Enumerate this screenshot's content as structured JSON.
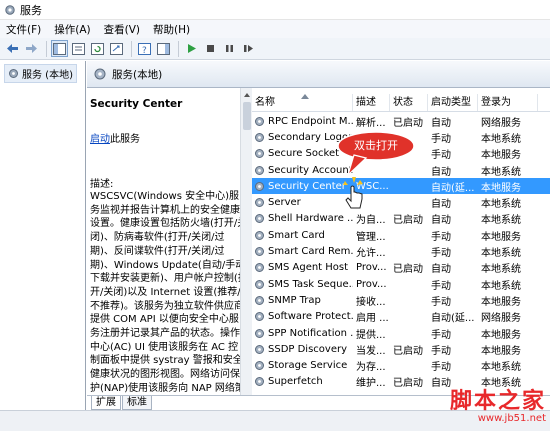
{
  "window": {
    "title": "服务"
  },
  "menu": [
    "文件(F)",
    "操作(A)",
    "查看(V)",
    "帮助(H)"
  ],
  "tree": {
    "root_label": "服务 (本地)"
  },
  "panel_header": "服务(本地)",
  "detail": {
    "service_name": "Security Center",
    "start_link": "启动",
    "start_suffix": "此服务",
    "desc_label": "描述:",
    "desc_text": "WSCSVC(Windows 安全中心)服务监视并报告计算机上的安全健康设置。健康设置包括防火墙(打开/关闭)、防病毒软件(打开/关闭/过期)、反间谍软件(打开/关闭/过期)、Windows Update(自动/手动下载并安装更新)、用户帐户控制(打开/关闭)以及 Internet 设置(推荐/不推荐)。该服务为独立软件供应商提供 COM API 以便向安全中心服务注册并记录其产品的状态。操作中心(AC) UI 使用该服务在 AC 控制面板中提供 systray 警报和安全健康状况的图形视图。网络访问保护(NAP)使用该服务向 NAP 网络策略服务报告客户端的"
  },
  "columns": [
    "名称",
    "描述",
    "状态",
    "启动类型",
    "登录为"
  ],
  "rows": [
    {
      "name": "RPC Endpoint M...",
      "desc": "解析...",
      "status": "已启动",
      "startup": "自动",
      "logon": "网络服务"
    },
    {
      "name": "Secondary Logon",
      "desc": "",
      "status": "",
      "startup": "手动",
      "logon": "本地系统"
    },
    {
      "name": "Secure Socket",
      "desc": "",
      "status": "",
      "startup": "手动",
      "logon": "本地服务"
    },
    {
      "name": "Security Account",
      "desc": "",
      "status": "",
      "startup": "自动",
      "logon": "本地系统"
    },
    {
      "name": "Security Center",
      "desc": "WSC...",
      "status": "",
      "startup": "自动(延...",
      "logon": "本地服务"
    },
    {
      "name": "Server",
      "desc": "",
      "status": "",
      "startup": "自动",
      "logon": "本地系统"
    },
    {
      "name": "Shell Hardware ...",
      "desc": "为自...",
      "status": "已启动",
      "startup": "自动",
      "logon": "本地系统"
    },
    {
      "name": "Smart Card",
      "desc": "管理...",
      "status": "",
      "startup": "手动",
      "logon": "本地服务"
    },
    {
      "name": "Smart Card Rem...",
      "desc": "允许...",
      "status": "",
      "startup": "手动",
      "logon": "本地系统"
    },
    {
      "name": "SMS Agent Host",
      "desc": "Prov...",
      "status": "已启动",
      "startup": "自动",
      "logon": "本地系统"
    },
    {
      "name": "SMS Task Seque...",
      "desc": "Prov...",
      "status": "",
      "startup": "手动",
      "logon": "本地系统"
    },
    {
      "name": "SNMP Trap",
      "desc": "接收...",
      "status": "",
      "startup": "手动",
      "logon": "本地服务"
    },
    {
      "name": "Software Protect...",
      "desc": "启用 ...",
      "status": "",
      "startup": "自动(延...",
      "logon": "网络服务"
    },
    {
      "name": "SPP Notification ...",
      "desc": "提供...",
      "status": "",
      "startup": "手动",
      "logon": "本地服务"
    },
    {
      "name": "SSDP Discovery",
      "desc": "当发...",
      "status": "已启动",
      "startup": "手动",
      "logon": "本地服务"
    },
    {
      "name": "Storage Service",
      "desc": "为存...",
      "status": "",
      "startup": "手动",
      "logon": "本地系统"
    },
    {
      "name": "Superfetch",
      "desc": "维护...",
      "status": "已启动",
      "startup": "自动",
      "logon": "本地系统"
    }
  ],
  "selected_index": 4,
  "tabs": [
    "扩展",
    "标准"
  ],
  "callout_text": "双击打开",
  "watermark": {
    "text": "脚本之家",
    "url": "www.jb51.net"
  },
  "colors": {
    "selection": "#3399ff",
    "callout": "#e0322a",
    "link": "#0645c0"
  }
}
